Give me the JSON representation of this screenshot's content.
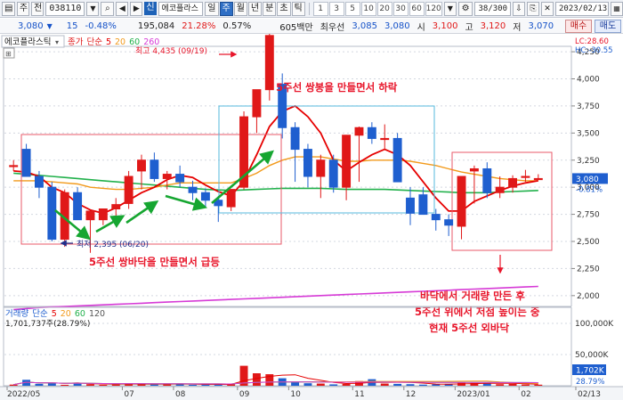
{
  "toolbar": {
    "menu_label": "주",
    "mode_label": "전",
    "code": "038110",
    "search_icon": "search-icon",
    "tag": "신",
    "name": "에코플라스",
    "periods": [
      "일",
      "주",
      "월",
      "년",
      "분",
      "초",
      "틱"
    ],
    "active_period": "주",
    "intervals": [
      "1",
      "3",
      "5",
      "10",
      "20",
      "30",
      "60",
      "120"
    ],
    "count": "38/300",
    "date": "2023/02/13"
  },
  "quote": {
    "price": "3,080",
    "change": "15",
    "change_pct": "-0.48%",
    "volume": "195,084",
    "turnover_pct": "21.28%",
    "extra_pct": "0.57%",
    "amount": "605백만",
    "pref_label": "최우선",
    "ask": "3,085",
    "bid": "3,080",
    "open_label": "시",
    "open": "3,100",
    "high_label": "고",
    "high": "3,120",
    "low_label": "저",
    "low": "3,070",
    "buy_label": "매수",
    "sell_label": "매도"
  },
  "chart_title": "에코플라스틱",
  "legend": {
    "price": [
      "종가",
      "단순",
      "5",
      "20",
      "60",
      "260"
    ],
    "volume": [
      "거래량",
      "단순",
      "5",
      "20",
      "60",
      "120"
    ],
    "volume_value": "1,701,737주(28.79%)"
  },
  "colors": {
    "up": "#e01818",
    "down": "#1f5fcf",
    "ma5": "#e60000",
    "ma20": "#f29a1b",
    "ma60": "#22b14c",
    "ma260": "#d63ad6",
    "annot_red": "#e8162b",
    "arrow_green": "#16a631"
  },
  "price_axis": {
    "lc": "LC:28.60",
    "hc": "HC:-30.55",
    "ticks": [
      "4,250",
      "4,000",
      "3,750",
      "3,500",
      "3,250",
      "3,000",
      "2,750",
      "2,500",
      "2,250",
      "2,000"
    ],
    "current_price": "3,080",
    "current_pct": "-0.81%"
  },
  "volume_axis": {
    "ticks": [
      "100,000K",
      "50,000K"
    ],
    "current": "1,702K",
    "current_pct": "28.79%"
  },
  "x_axis": [
    "2022/05",
    "07",
    "08",
    "09",
    "10",
    "11",
    "12",
    "2023/01",
    "02",
    "02/13"
  ],
  "annotations": {
    "high_marker": "최고 4,435 (09/19)",
    "low_marker": "최저 2,395 (06/20)",
    "double_top": "5주선 쌍봉을 만들면서 하락",
    "double_bottom": "5주선 쌍바닥을 만들면서 급등",
    "note_line1": "바닥에서 거래량 만든 후",
    "note_line2": "5주선 위에서 저점 높이는 중",
    "note_line3": "현재 5주선 외바닥"
  },
  "chart_data": {
    "type": "candlestick",
    "x": [
      "2022-05-02",
      "2022-05-09",
      "2022-05-16",
      "2022-05-23",
      "2022-05-30",
      "2022-06-06",
      "2022-06-13",
      "2022-06-20",
      "2022-06-27",
      "2022-07-04",
      "2022-07-11",
      "2022-07-18",
      "2022-07-25",
      "2022-08-01",
      "2022-08-08",
      "2022-08-15",
      "2022-08-22",
      "2022-08-29",
      "2022-09-05",
      "2022-09-12",
      "2022-09-19",
      "2022-09-26",
      "2022-10-03",
      "2022-10-10",
      "2022-10-17",
      "2022-10-24",
      "2022-10-31",
      "2022-11-07",
      "2022-11-14",
      "2022-11-21",
      "2022-11-28",
      "2022-12-05",
      "2022-12-12",
      "2022-12-19",
      "2022-12-26",
      "2023-01-02",
      "2023-01-09",
      "2023-01-16",
      "2023-01-23",
      "2023-01-30",
      "2023-02-06",
      "2023-02-13"
    ],
    "open": [
      3200,
      3350,
      3100,
      3000,
      2520,
      2950,
      2700,
      2700,
      2800,
      2850,
      3150,
      3250,
      3080,
      3120,
      3000,
      2950,
      2880,
      2820,
      3000,
      3650,
      3900,
      3950,
      3550,
      3350,
      3100,
      3250,
      3000,
      3480,
      3550,
      3450,
      3450,
      2900,
      2930,
      2750,
      2700,
      2640,
      3150,
      3170,
      2950,
      3000,
      3100,
      3080
    ],
    "high": [
      3250,
      3400,
      3150,
      3050,
      2980,
      3000,
      2760,
      2780,
      2900,
      3150,
      3300,
      3320,
      3150,
      3200,
      3060,
      2990,
      2920,
      2980,
      3700,
      3900,
      4435,
      4050,
      3600,
      3400,
      3300,
      3300,
      3050,
      3560,
      3600,
      3580,
      3500,
      3000,
      3000,
      2800,
      2750,
      2820,
      3200,
      3230,
      3100,
      3110,
      3160,
      3120
    ],
    "low": [
      3150,
      3250,
      2900,
      2500,
      2450,
      2750,
      2395,
      2650,
      2680,
      2800,
      2980,
      3050,
      2980,
      3000,
      2880,
      2820,
      2680,
      2780,
      2980,
      3500,
      3800,
      3450,
      3050,
      3000,
      2900,
      2950,
      2880,
      3050,
      3400,
      3350,
      3050,
      2650,
      2750,
      2600,
      2550,
      2520,
      2850,
      2900,
      2900,
      2950,
      3050,
      3070
    ],
    "close": [
      3200,
      3100,
      3000,
      2520,
      2950,
      2700,
      2780,
      2800,
      2840,
      3100,
      3250,
      3080,
      3120,
      3050,
      2950,
      2880,
      2830,
      2980,
      3650,
      3900,
      4400,
      3550,
      3350,
      3100,
      3250,
      3000,
      3480,
      3550,
      3450,
      3450,
      3050,
      2760,
      2750,
      2700,
      2650,
      3100,
      3170,
      2950,
      3000,
      3080,
      3100,
      3080
    ],
    "ma5": [
      3150,
      3140,
      3100,
      3000,
      2950,
      2850,
      2790,
      2760,
      2810,
      2880,
      2950,
      3000,
      3070,
      3110,
      3090,
      3020,
      2960,
      2920,
      3060,
      3300,
      3560,
      3700,
      3750,
      3650,
      3500,
      3250,
      3150,
      3230,
      3300,
      3350,
      3300,
      3200,
      3050,
      2900,
      2780,
      2780,
      2870,
      2920,
      2970,
      3010,
      3040,
      3060
    ],
    "ma20": [
      3060,
      3060,
      3060,
      3050,
      3040,
      3030,
      3000,
      2990,
      2980,
      2980,
      2990,
      3000,
      3020,
      3040,
      3040,
      3040,
      3040,
      3040,
      3080,
      3130,
      3200,
      3250,
      3280,
      3280,
      3280,
      3260,
      3240,
      3240,
      3250,
      3250,
      3250,
      3240,
      3220,
      3200,
      3170,
      3140,
      3120,
      3100,
      3080,
      3070,
      3060,
      3060
    ],
    "ma60": [
      3130,
      3120,
      3110,
      3100,
      3090,
      3080,
      3070,
      3060,
      3050,
      3040,
      3030,
      3020,
      3010,
      3000,
      2990,
      2980,
      2975,
      2970,
      2975,
      2980,
      2985,
      2990,
      2990,
      2990,
      2990,
      2985,
      2980,
      2980,
      2980,
      2980,
      2975,
      2970,
      2965,
      2960,
      2955,
      2950,
      2950,
      2950,
      2955,
      2960,
      2965,
      2970
    ],
    "ma260": [
      1870,
      1880,
      1890,
      1895,
      1900,
      1905,
      1910,
      1915,
      1920,
      1925,
      1930,
      1935,
      1940,
      1945,
      1950,
      1955,
      1960,
      1965,
      1970,
      1975,
      1980,
      1985,
      1990,
      1995,
      2000,
      2005,
      2010,
      2015,
      2020,
      2025,
      2030,
      2035,
      2040,
      2045,
      2050,
      2055,
      2060,
      2065,
      2070,
      2075,
      2080,
      2085
    ],
    "volume": [
      1800,
      9500,
      3000,
      4000,
      1500,
      5000,
      2500,
      1500,
      2000,
      3000,
      3500,
      2000,
      2200,
      2800,
      1500,
      2200,
      1800,
      2500,
      32000,
      20000,
      18500,
      12000,
      5500,
      4000,
      3500,
      2200,
      3000,
      7500,
      10500,
      3500,
      3000,
      2500,
      1800,
      2500,
      3000,
      5500,
      4500,
      3500,
      2500,
      3000,
      2000,
      1702
    ],
    "ylim": [
      1900,
      4300
    ],
    "volume_ylim": [
      0,
      110000
    ]
  }
}
